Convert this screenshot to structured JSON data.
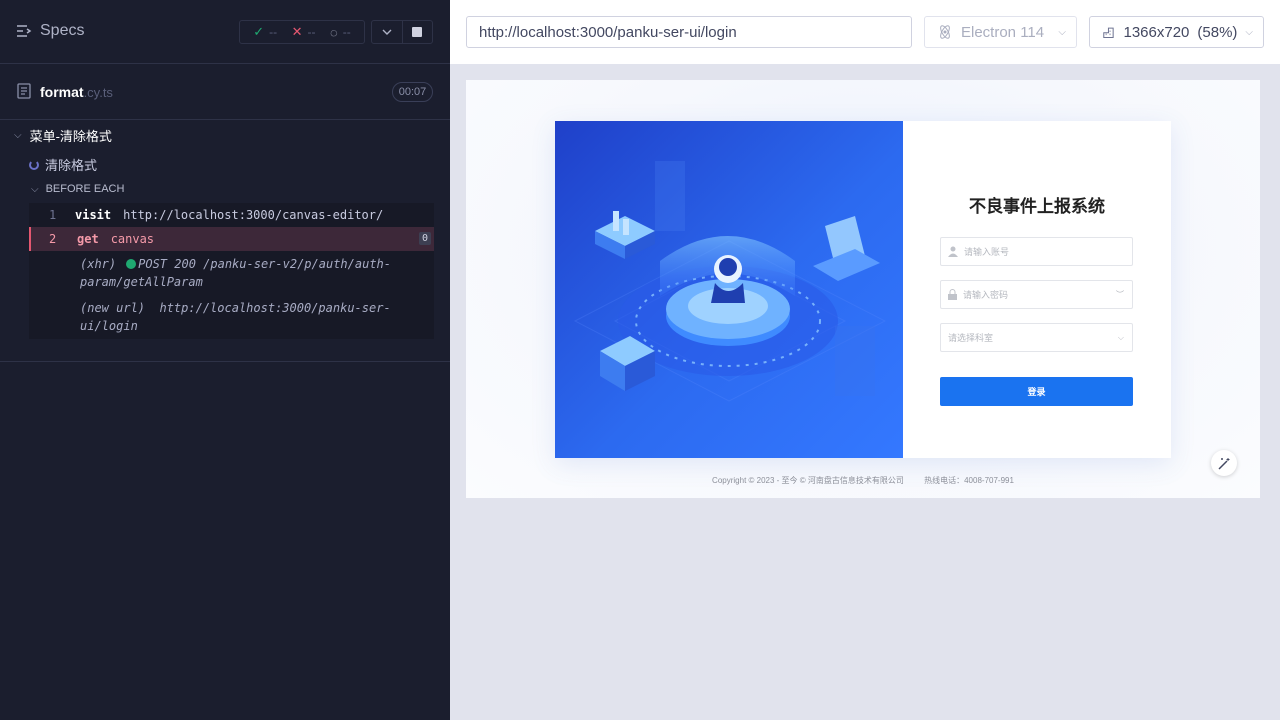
{
  "reporter": {
    "specs_label": "Specs",
    "stats": {
      "passed": "--",
      "failed": "--",
      "pending": "--"
    },
    "file": {
      "name": "format",
      "ext": ".cy.ts",
      "duration": "00:07"
    },
    "suite_title": "菜单-清除格式",
    "test_title": "清除格式",
    "hook_title": "BEFORE EACH",
    "commands": [
      {
        "num": "1",
        "name": "visit",
        "message": "http://localhost:3000/canvas-editor/"
      },
      {
        "num": "2",
        "name": "get",
        "message": "canvas",
        "badge": "0"
      }
    ],
    "xhr": {
      "label": "(xhr)",
      "text": "POST 200 /panku-ser-v2/p/auth/auth-param/getAllParam"
    },
    "new_url": {
      "label": "(new url)",
      "text": "http://localhost:3000/panku-ser-ui/login"
    }
  },
  "aut": {
    "url": "http://localhost:3000/panku-ser-ui/login",
    "browser": "Electron 114",
    "viewport": "1366x720",
    "scale": "(58%)"
  },
  "app": {
    "system_title": "不良事件上报系统",
    "account_placeholder": "请输入账号",
    "password_placeholder": "请输入密码",
    "dept_placeholder": "请选择科室",
    "login_label": "登录",
    "copyright": "Copyright © 2023 - 至今 © 河南盘古信息技术有限公司",
    "hotline": "热线电话：4008-707-991"
  },
  "colors": {
    "reporter_bg": "#1b1e2e",
    "pass": "#1fa971",
    "fail": "#e45770",
    "login_button": "#1a73f0"
  }
}
